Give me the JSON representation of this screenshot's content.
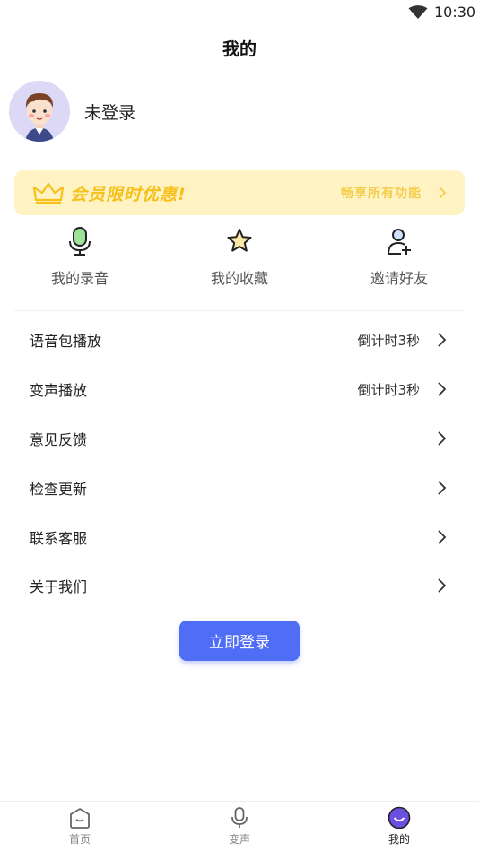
{
  "status_bar": {
    "time": "10:30",
    "icons": [
      "wifi-icon"
    ]
  },
  "page": {
    "title": "我的"
  },
  "profile": {
    "username": "未登录",
    "avatar_icon": "cartoon-avatar"
  },
  "vip": {
    "title": "会员限时优惠!",
    "subtitle": "畅享所有功能",
    "icon": "crown-icon",
    "accent_color": "#f6c019",
    "background_color": "#fff3c4"
  },
  "shortcuts": [
    {
      "label": "我的录音",
      "icon": "microphone-icon"
    },
    {
      "label": "我的收藏",
      "icon": "star-icon"
    },
    {
      "label": "邀请好友",
      "icon": "add-user-icon"
    }
  ],
  "menu": [
    {
      "label": "语音包播放",
      "value": "倒计时3秒"
    },
    {
      "label": "变声播放",
      "value": "倒计时3秒"
    },
    {
      "label": "意见反馈",
      "value": ""
    },
    {
      "label": "检查更新",
      "value": ""
    },
    {
      "label": "联系客服",
      "value": ""
    },
    {
      "label": "关于我们",
      "value": ""
    }
  ],
  "login_button": {
    "label": "立即登录",
    "color": "#4f6df5"
  },
  "tabbar": {
    "tabs": [
      {
        "label": "首页",
        "icon": "home-icon",
        "active": false
      },
      {
        "label": "变声",
        "icon": "microphone-icon",
        "active": false
      },
      {
        "label": "我的",
        "icon": "profile-face-icon",
        "active": true
      }
    ],
    "active_color": "#6b4fe0"
  }
}
